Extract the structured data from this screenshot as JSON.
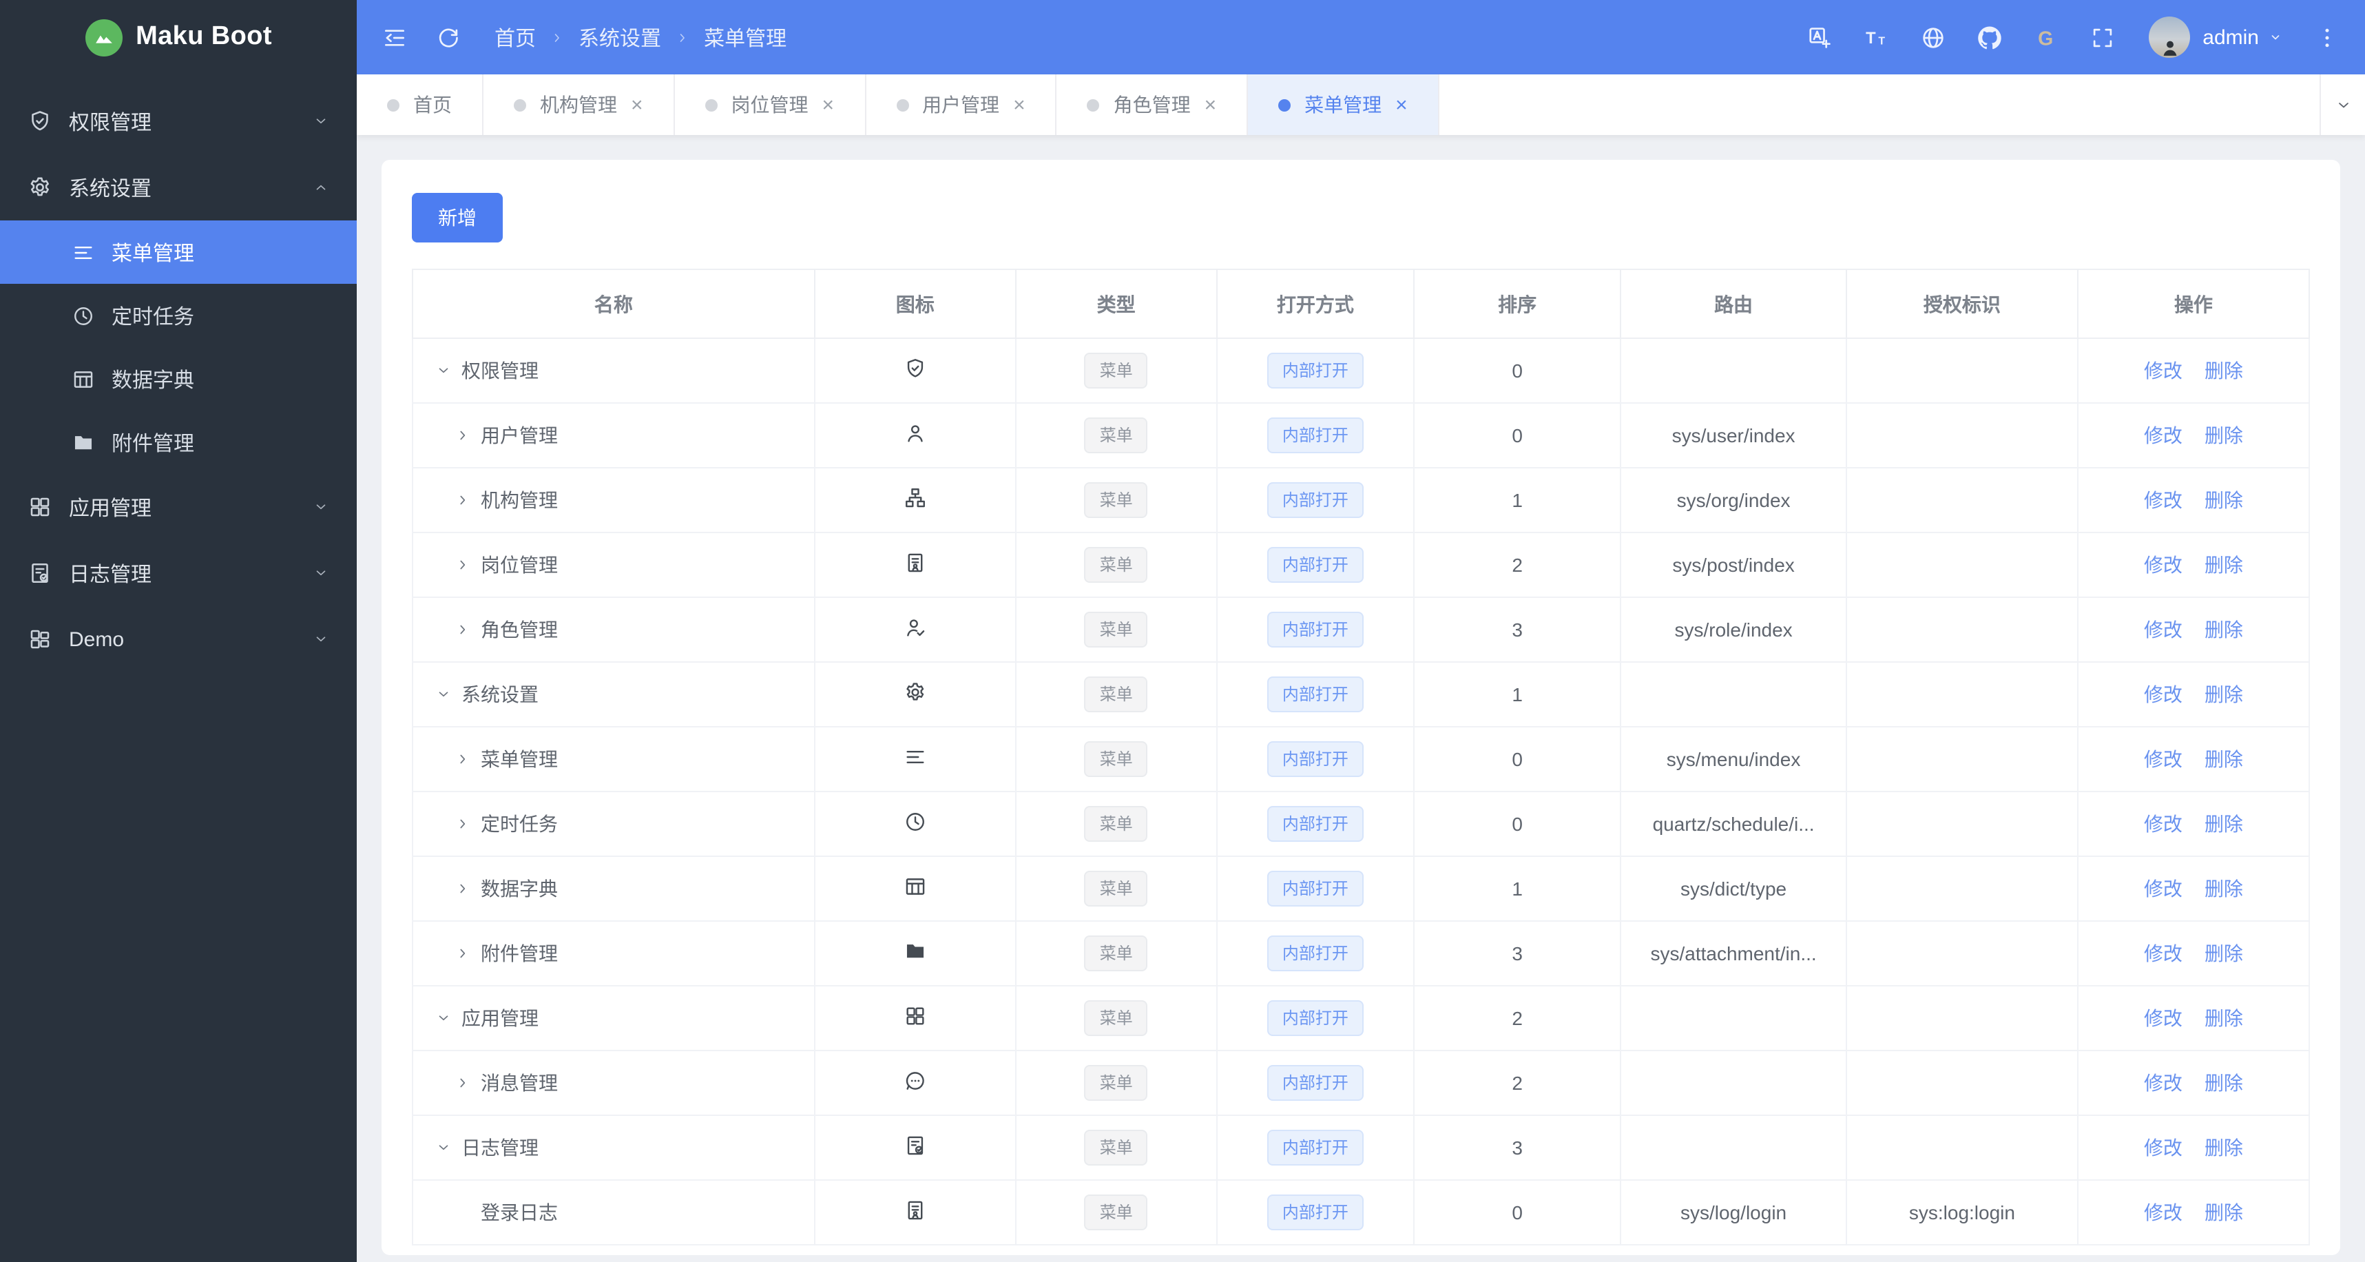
{
  "app": {
    "title": "Maku Boot"
  },
  "colors": {
    "primary": "#5583ee",
    "sidebar_bg": "#29323d",
    "page_bg": "#eef0f4",
    "logo_green": "#5cb85f",
    "link_blue": "#6992ef"
  },
  "sidebar": {
    "items": [
      {
        "label": "权限管理",
        "icon": "shield-check-icon",
        "state": "collapsed"
      },
      {
        "label": "系统设置",
        "icon": "gear-icon",
        "state": "expanded"
      },
      {
        "label": "菜单管理",
        "icon": "menu-lines-icon",
        "child": true,
        "active": true
      },
      {
        "label": "定时任务",
        "icon": "clock-icon",
        "child": true
      },
      {
        "label": "数据字典",
        "icon": "dict-table-icon",
        "child": true
      },
      {
        "label": "附件管理",
        "icon": "folder-icon",
        "child": true
      },
      {
        "label": "应用管理",
        "icon": "app-grid-icon",
        "state": "collapsed"
      },
      {
        "label": "日志管理",
        "icon": "log-doc-icon",
        "state": "collapsed"
      },
      {
        "label": "Demo",
        "icon": "demo-grid-icon",
        "state": "collapsed"
      }
    ]
  },
  "header": {
    "left_icons": [
      "menu-fold-icon",
      "refresh-icon"
    ],
    "breadcrumb": [
      "首页",
      "系统设置",
      "菜单管理"
    ],
    "right_icons": [
      "translate-icon",
      "font-size-icon",
      "globe-icon",
      "github-icon",
      "gitee-icon",
      "fullscreen-icon"
    ],
    "user": {
      "name": "admin",
      "avatar_icon": "person-silhouette-icon",
      "caret_icon": "caret-down-icon"
    },
    "more_icon": "more-dots-icon"
  },
  "tabs": [
    {
      "label": "首页",
      "closable": false,
      "active": false
    },
    {
      "label": "机构管理",
      "closable": true,
      "active": false
    },
    {
      "label": "岗位管理",
      "closable": true,
      "active": false
    },
    {
      "label": "用户管理",
      "closable": true,
      "active": false
    },
    {
      "label": "角色管理",
      "closable": true,
      "active": false
    },
    {
      "label": "菜单管理",
      "closable": true,
      "active": true
    }
  ],
  "tabbar": {
    "overflow_icon": "chevron-down-icon"
  },
  "toolbar": {
    "add_label": "新增"
  },
  "table": {
    "columns": [
      "名称",
      "图标",
      "类型",
      "打开方式",
      "排序",
      "路由",
      "授权标识",
      "操作"
    ],
    "type_label": "菜单",
    "open_label": "内部打开",
    "actions": {
      "edit": "修改",
      "delete": "删除"
    },
    "rows": [
      {
        "name": "权限管理",
        "level": 0,
        "arrow": "down",
        "icon": "shield-check-icon",
        "sort": "0",
        "route": "",
        "auth": ""
      },
      {
        "name": "用户管理",
        "level": 1,
        "arrow": "right",
        "icon": "user-icon",
        "sort": "0",
        "route": "sys/user/index",
        "auth": ""
      },
      {
        "name": "机构管理",
        "level": 1,
        "arrow": "right",
        "icon": "org-tree-icon",
        "sort": "1",
        "route": "sys/org/index",
        "auth": ""
      },
      {
        "name": "岗位管理",
        "level": 1,
        "arrow": "right",
        "icon": "post-card-icon",
        "sort": "2",
        "route": "sys/post/index",
        "auth": ""
      },
      {
        "name": "角色管理",
        "level": 1,
        "arrow": "right",
        "icon": "user-check-icon",
        "sort": "3",
        "route": "sys/role/index",
        "auth": ""
      },
      {
        "name": "系统设置",
        "level": 0,
        "arrow": "down",
        "icon": "gear-icon",
        "sort": "1",
        "route": "",
        "auth": ""
      },
      {
        "name": "菜单管理",
        "level": 1,
        "arrow": "right",
        "icon": "menu-lines-icon",
        "sort": "0",
        "route": "sys/menu/index",
        "auth": ""
      },
      {
        "name": "定时任务",
        "level": 1,
        "arrow": "right",
        "icon": "clock-icon",
        "sort": "0",
        "route": "quartz/schedule/i...",
        "auth": ""
      },
      {
        "name": "数据字典",
        "level": 1,
        "arrow": "right",
        "icon": "dict-table-icon",
        "sort": "1",
        "route": "sys/dict/type",
        "auth": ""
      },
      {
        "name": "附件管理",
        "level": 1,
        "arrow": "right",
        "icon": "folder-icon",
        "sort": "3",
        "route": "sys/attachment/in...",
        "auth": ""
      },
      {
        "name": "应用管理",
        "level": 0,
        "arrow": "down",
        "icon": "app-grid-icon",
        "sort": "2",
        "route": "",
        "auth": ""
      },
      {
        "name": "消息管理",
        "level": 1,
        "arrow": "right",
        "icon": "message-icon",
        "sort": "2",
        "route": "",
        "auth": ""
      },
      {
        "name": "日志管理",
        "level": 0,
        "arrow": "down",
        "icon": "log-doc-icon",
        "sort": "3",
        "route": "",
        "auth": ""
      },
      {
        "name": "登录日志",
        "level": 1,
        "arrow": "none",
        "icon": "post-card-icon",
        "sort": "0",
        "route": "sys/log/login",
        "auth": "sys:log:login"
      }
    ]
  }
}
